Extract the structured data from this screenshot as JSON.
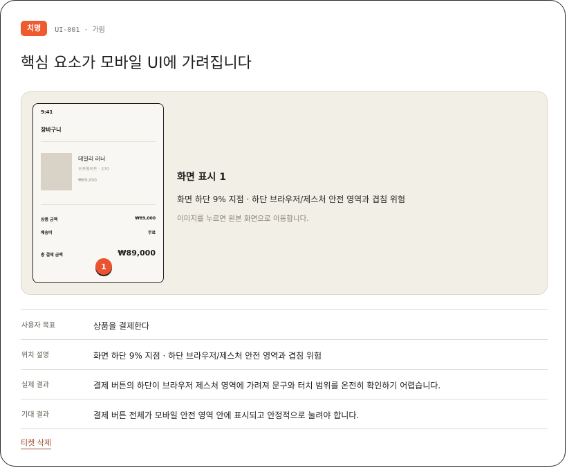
{
  "header": {
    "badge": "치명",
    "ticket_id": "UI-001",
    "separator": "·",
    "category": "가림"
  },
  "title": "핵심 요소가 모바일 UI에 가려집니다",
  "colors": {
    "accent": "#ef5a2e",
    "preview_bg": "#f2efe7",
    "link": "#a0492c"
  },
  "phone": {
    "time": "9:41",
    "screen_title": "장바구니",
    "product": {
      "name": "데일리 러너",
      "option": "오프화이트 · 270",
      "price": "₩89,000"
    },
    "summary": [
      {
        "label": "상품 금액",
        "value": "₩89,000"
      },
      {
        "label": "배송비",
        "value": "무료"
      }
    ],
    "total_label": "총 결제 금액",
    "total_value": "₩89,000",
    "marker": "1"
  },
  "info": {
    "title": "화면 표시 1",
    "description": "화면 하단 9% 지점 · 하단 브라우저/제스처 안전 영역과 겹침 위험",
    "hint": "이미지를 누르면 원본 화면으로 이동합니다."
  },
  "details": [
    {
      "label": "사용자 목표",
      "value": "상품을 결제한다"
    },
    {
      "label": "위치 설명",
      "value": "화면 하단 9% 지점 · 하단 브라우저/제스처 안전 영역과 겹침 위험"
    },
    {
      "label": "실제 결과",
      "value": "결제 버튼의 하단이 브라우저 제스처 영역에 가려져 문구와 터치 범위를 온전히 확인하기 어렵습니다."
    },
    {
      "label": "기대 결과",
      "value": "결제 버튼 전체가 모바일 안전 영역 안에 표시되고 안정적으로 눌려야 합니다."
    }
  ],
  "delete_label": "티켓 삭제"
}
